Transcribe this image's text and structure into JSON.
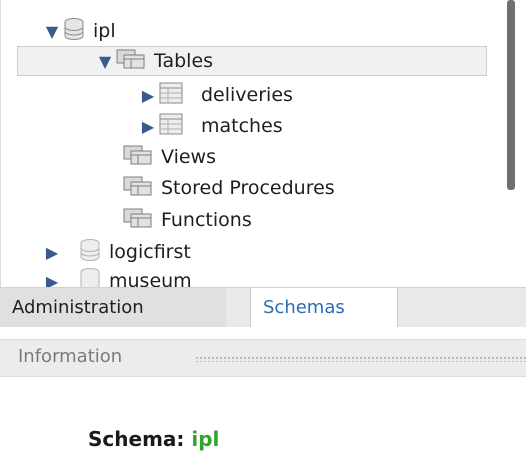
{
  "tree": {
    "partial_top_item": "...",
    "items": [
      {
        "label": "ipl",
        "type": "schema",
        "expanded": true
      },
      {
        "label": "Tables",
        "type": "folder",
        "expanded": true,
        "selected": true
      },
      {
        "label": "deliveries",
        "type": "table",
        "expanded": false
      },
      {
        "label": "matches",
        "type": "table",
        "expanded": false
      },
      {
        "label": "Views",
        "type": "folder"
      },
      {
        "label": "Stored Procedures",
        "type": "folder"
      },
      {
        "label": "Functions",
        "type": "folder"
      },
      {
        "label": "logicfirst",
        "type": "schema",
        "expanded": false
      },
      {
        "label": "museum",
        "type": "schema",
        "expanded": false
      }
    ]
  },
  "tabs": [
    {
      "label": "Administration",
      "active": false
    },
    {
      "label": "Schemas",
      "active": true
    }
  ],
  "info": {
    "title": "Information",
    "schema_label": "Schema:",
    "schema_value": "ipl"
  },
  "colors": {
    "accent_blue": "#2b6cb0",
    "schema_green": "#2fa52f",
    "arrow": "#3a5a8c"
  },
  "icons": {
    "expanded": "triangle-down-icon",
    "collapsed": "triangle-right-icon",
    "schema": "database-icon",
    "folder": "folder-icon",
    "table": "table-icon"
  }
}
